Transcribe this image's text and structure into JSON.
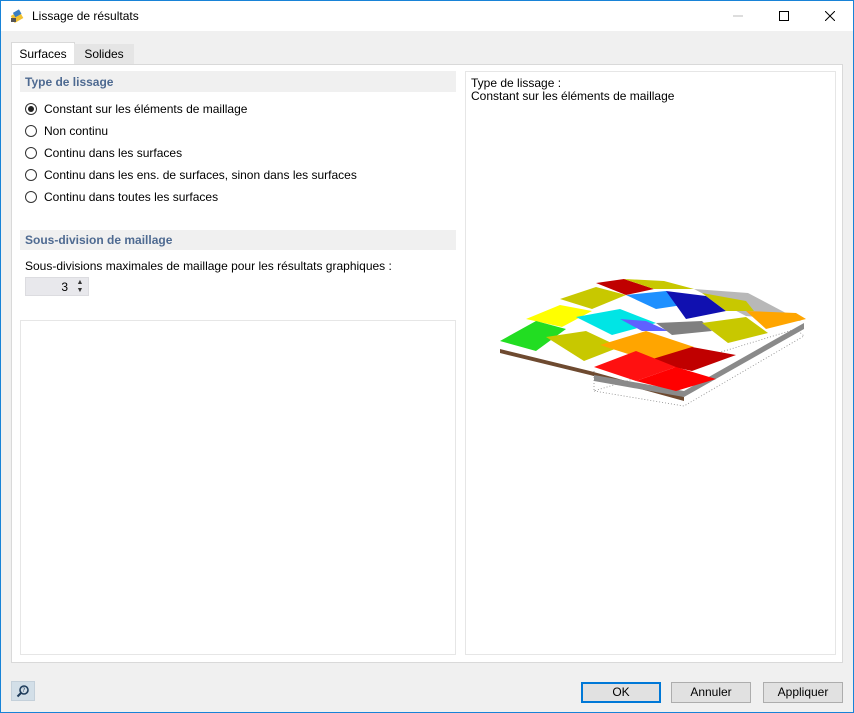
{
  "window": {
    "title": "Lissage de résultats",
    "icon": "results-smoothing-icon"
  },
  "tabs": [
    {
      "label": "Surfaces",
      "active": true
    },
    {
      "label": "Solides",
      "active": false
    }
  ],
  "smoothing_type": {
    "title": "Type de lissage",
    "options": [
      {
        "label": "Constant sur les éléments de maillage",
        "checked": true
      },
      {
        "label": "Non continu",
        "checked": false
      },
      {
        "label": "Continu dans les surfaces",
        "checked": false
      },
      {
        "label": "Continu dans les ens. de surfaces, sinon dans les surfaces",
        "checked": false
      },
      {
        "label": "Continu dans toutes les surfaces",
        "checked": false
      }
    ]
  },
  "mesh_subdivision": {
    "title": "Sous-division de maillage",
    "label": "Sous-divisions maximales de maillage pour les résultats graphiques :",
    "value": "3"
  },
  "preview": {
    "caption_line1": "Type de lissage :",
    "caption_line2": "Constant sur les éléments de maillage"
  },
  "footer": {
    "help_icon": "help-magnifier-icon",
    "ok": "OK",
    "cancel": "Annuler",
    "apply": "Appliquer"
  },
  "colors": {
    "accent": "#0078d7",
    "group_title": "#4e6a91"
  }
}
